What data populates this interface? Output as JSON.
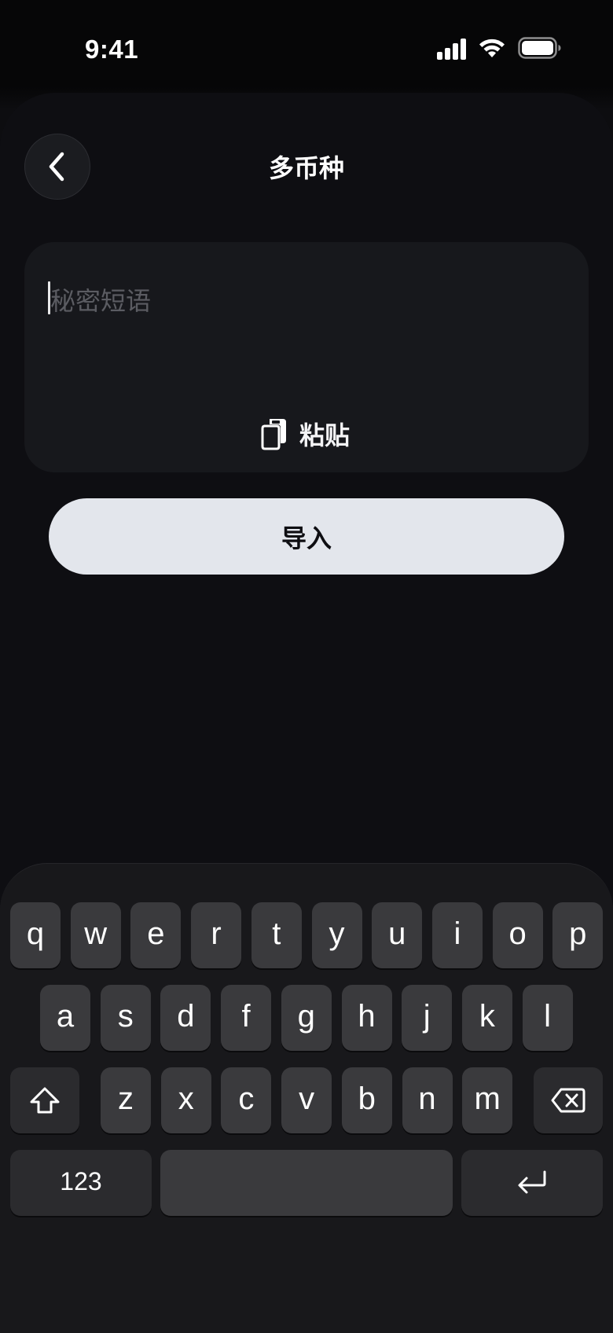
{
  "status_bar": {
    "time": "9:41",
    "icons": [
      "cellular-signal-icon",
      "wifi-icon",
      "battery-icon"
    ]
  },
  "header": {
    "title": "多币种",
    "back_icon": "chevron-left-icon"
  },
  "phrase_input": {
    "placeholder": "秘密短语",
    "value": "",
    "paste_icon": "clipboard-icon",
    "paste_label": "粘贴"
  },
  "import_button": {
    "label": "导入"
  },
  "keyboard": {
    "row1": [
      "q",
      "w",
      "e",
      "r",
      "t",
      "y",
      "u",
      "i",
      "o",
      "p"
    ],
    "row2": [
      "a",
      "s",
      "d",
      "f",
      "g",
      "h",
      "j",
      "k",
      "l"
    ],
    "row3": [
      "z",
      "x",
      "c",
      "v",
      "b",
      "n",
      "m"
    ],
    "shift_icon": "shift-icon",
    "delete_icon": "delete-icon",
    "numbers_label": "123",
    "return_icon": "return-icon"
  },
  "colors": {
    "background": "#0e0e12",
    "card": "#17181c",
    "button": "#e3e6ec",
    "placeholder": "#5b5c62",
    "key": "#3a3a3d"
  }
}
